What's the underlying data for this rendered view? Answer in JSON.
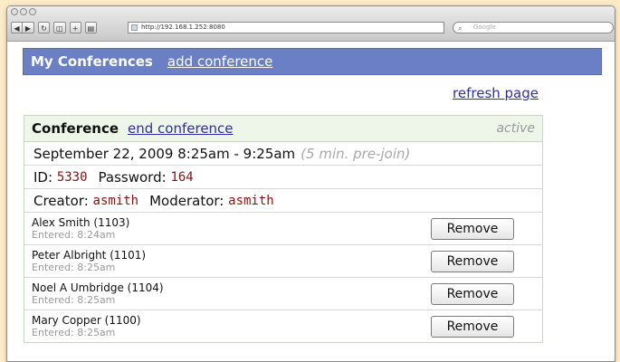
{
  "browser": {
    "url": "http://192.168.1.252:8080",
    "search_placeholder": "Google",
    "nav_icons": [
      "back-icon",
      "forward-icon",
      "reload-icon",
      "rss-icon",
      "add-bookmark-icon",
      "print-icon"
    ]
  },
  "header": {
    "title": "My Conferences",
    "add_link": "add conference"
  },
  "refresh_link": "refresh page",
  "conference": {
    "label": "Conference",
    "end_link": "end conference",
    "status": "active",
    "datetime": "September 22, 2009 8:25am - 9:25am",
    "prejoin": "(5 min. pre-join)",
    "id_label": "ID:",
    "id_value": "5330",
    "password_label": "Password:",
    "password_value": "164",
    "creator_label": "Creator:",
    "creator_value": "asmith",
    "moderator_label": "Moderator:",
    "moderator_value": "asmith"
  },
  "participants": [
    {
      "name": "Alex Smith (1103)",
      "entered": "Entered: 8:24am",
      "action": "Remove"
    },
    {
      "name": "Peter Albright (1101)",
      "entered": "Entered: 8:25am",
      "action": "Remove"
    },
    {
      "name": "Noel A Umbridge (1104)",
      "entered": "Entered: 8:25am",
      "action": "Remove"
    },
    {
      "name": "Mary Copper (1100)",
      "entered": "Entered: 8:25am",
      "action": "Remove"
    }
  ],
  "colors": {
    "header_bg": "#6b7fc4",
    "link": "#2e2ea8",
    "mono_value": "#8b1010",
    "page_bg": "#fdebc8"
  }
}
